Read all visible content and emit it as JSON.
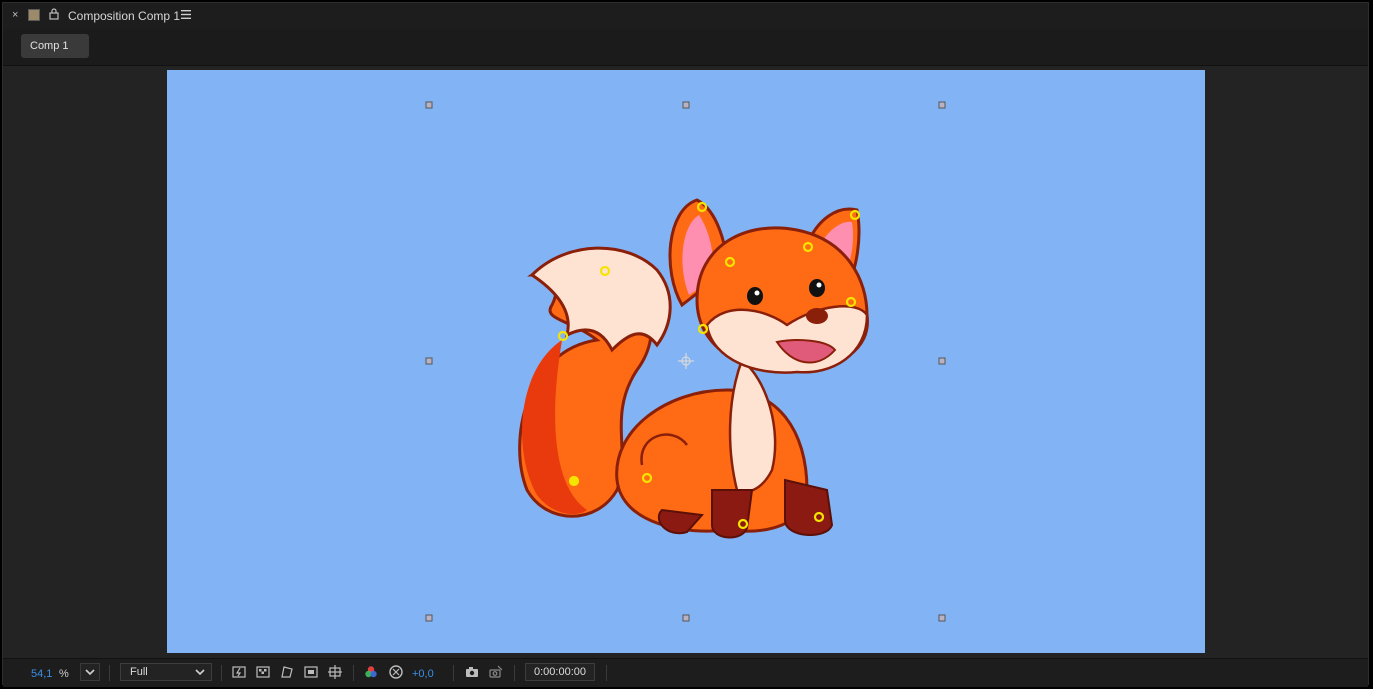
{
  "panel": {
    "title": "Composition Comp 1",
    "close_icon": "close-icon",
    "lock_icon": "lock-icon",
    "menu_icon": "hamburger-menu-icon",
    "label_color": "#9c8a6a"
  },
  "tabs": [
    {
      "label": "Comp 1",
      "active": true
    }
  ],
  "viewer": {
    "background_color": "#82b4f5",
    "image": "cartoon-fox-illustration"
  },
  "toolbar": {
    "zoom_value": "54,1",
    "zoom_unit": "%",
    "resolution": "Full",
    "exposure": "+0,0",
    "timecode": "0:00:00:00",
    "icons": [
      "fast-previews-icon",
      "transparency-grid-icon",
      "mask-path-visibility-icon",
      "region-of-interest-icon",
      "grid-guides-icon",
      "color-channels-icon",
      "reset-exposure-icon",
      "snapshot-camera-icon",
      "show-snapshot-icon"
    ]
  }
}
